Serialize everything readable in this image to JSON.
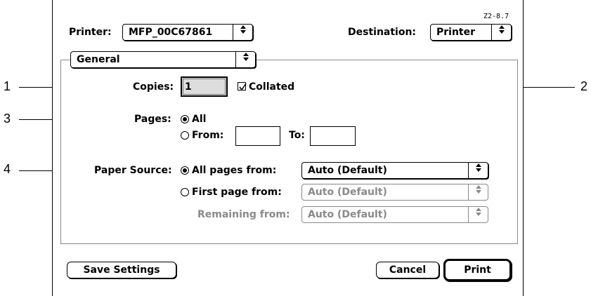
{
  "version_label": "Z2-8.7",
  "printer": {
    "label": "Printer:",
    "value": "MFP_00C67861"
  },
  "destination": {
    "label": "Destination:",
    "value": "Printer"
  },
  "panel": {
    "value": "General"
  },
  "copies": {
    "label": "Copies:",
    "value": "1"
  },
  "collated": {
    "label": "Collated",
    "checked": true
  },
  "pages": {
    "label": "Pages:",
    "all_label": "All",
    "from_label": "From:",
    "to_label": "To:",
    "from_value": "",
    "to_value": "",
    "selected": "all"
  },
  "paper_source": {
    "label": "Paper Source:",
    "all_pages_label": "All pages from:",
    "all_pages_value": "Auto (Default)",
    "first_page_label": "First page from:",
    "first_page_value": "Auto (Default)",
    "remaining_label": "Remaining from:",
    "remaining_value": "Auto (Default)",
    "selected": "all_pages"
  },
  "buttons": {
    "save_settings": "Save Settings",
    "cancel": "Cancel",
    "print": "Print"
  },
  "callouts": [
    "1",
    "2",
    "3",
    "4"
  ],
  "icons": {
    "popup_arrow": "updown-arrows-icon",
    "check": "checkmark-icon"
  }
}
